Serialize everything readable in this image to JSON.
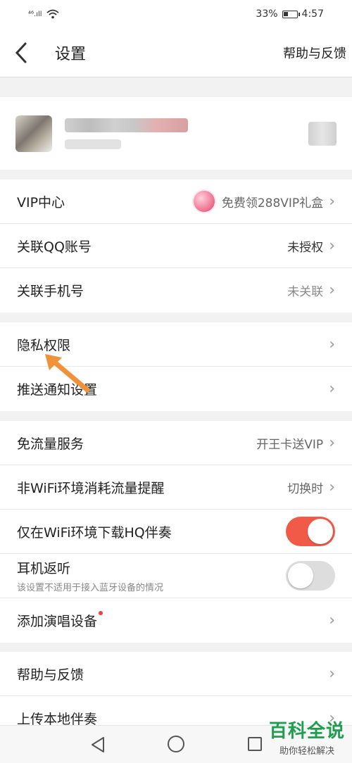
{
  "status_bar": {
    "signal": "⁴⁶.ıll",
    "battery_percent": "33%",
    "time": "4:57"
  },
  "header": {
    "back_icon": "chevron-left-icon",
    "title": "设置",
    "help_label": "帮助与反馈"
  },
  "account_group": {
    "items": [
      {
        "label": "VIP中心",
        "value": "免费领288VIP礼盒"
      },
      {
        "label": "关联QQ账号",
        "value": "未授权"
      },
      {
        "label": "关联手机号",
        "value": "未关联"
      }
    ]
  },
  "privacy_group": {
    "items": [
      {
        "label": "隐私权限"
      },
      {
        "label": "推送通知设置"
      }
    ]
  },
  "settings_group": {
    "items": [
      {
        "label": "免流量服务",
        "value": "开王卡送VIP"
      },
      {
        "label": "非WiFi环境消耗流量提醒",
        "value": "切换时"
      },
      {
        "label": "仅在WiFi环境下载HQ伴奏",
        "toggle": "on"
      },
      {
        "label": "耳机返听",
        "sublabel": "该设置不适用于接入蓝牙设备的情况",
        "toggle": "off"
      },
      {
        "label": "添加演唱设备"
      }
    ]
  },
  "help_group": {
    "items": [
      {
        "label": "帮助与反馈"
      },
      {
        "label": "上传本地伴奏"
      }
    ]
  },
  "watermark": {
    "title": "百科全说",
    "subtitle": "助你轻松解决"
  },
  "colors": {
    "toggle_on": "#f25a48",
    "toggle_off": "#dddddd",
    "annotation_arrow": "#f0923a",
    "watermark_green": "#1f9e4f"
  }
}
